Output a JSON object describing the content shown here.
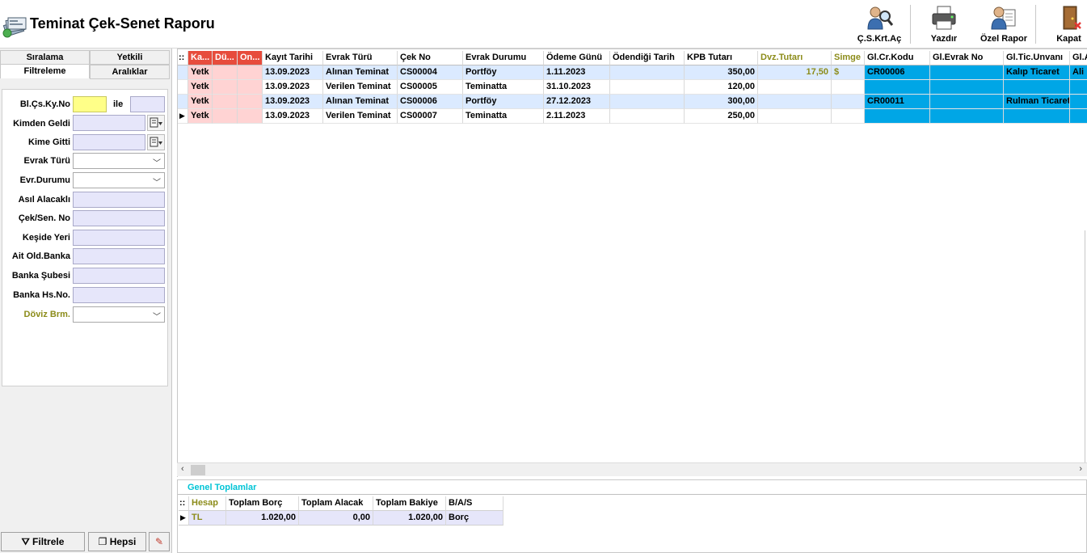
{
  "title": "Teminat Çek-Senet Raporu",
  "toolbar": {
    "cs_krt_ac": "Ç.S.Krt.Aç",
    "yazdir": "Yazdır",
    "ozel_rapor": "Özel Rapor",
    "kapat": "Kapat"
  },
  "tabs": {
    "siralama": "Sıralama",
    "yetkili": "Yetkili",
    "filtreleme": "Filtreleme",
    "araliklar": "Aralıklar"
  },
  "filters": {
    "bl_cs_ky_no": "Bl.Çs.Ky.No",
    "ile": "ile",
    "kimden_geldi": "Kimden Geldi",
    "kime_gitti": "Kime Gitti",
    "evrak_turu": "Evrak Türü",
    "evr_durumu": "Evr.Durumu",
    "asil_alacakli": "Asıl Alacaklı",
    "cek_sen_no": "Çek/Sen. No",
    "keside_yeri": "Keşide Yeri",
    "ait_old_banka": "Ait Old.Banka",
    "banka_subesi": "Banka Şubesi",
    "banka_hs_no": "Banka Hs.No.",
    "doviz_brm": "Döviz Brm."
  },
  "buttons": {
    "filtrele": "Filtrele",
    "hepsi": "Hepsi"
  },
  "grid": {
    "corner": "::",
    "columns": [
      "Ka...",
      "Dü...",
      "On...",
      "Kayıt Tarihi",
      "Evrak Türü",
      "Çek No",
      "Evrak Durumu",
      "Ödeme Günü",
      "Ödendiği Tarih",
      "KPB Tutarı",
      "Dvz.Tutarı",
      "Simge",
      "Gl.Cr.Kodu",
      "Gl.Evrak No",
      "Gl.Tic.Unvanı",
      "Gl.A"
    ],
    "rows": [
      {
        "ka": "Yetk",
        "kayit_tarihi": "13.09.2023",
        "evrak_turu": "Alınan Teminat",
        "cek_no": "CS00004",
        "evrak_durumu": "Portföy",
        "odeme_gunu": "1.11.2023",
        "odendigi_tarih": "",
        "kpb_tutari": "350,00",
        "dvz_tutari": "17,50",
        "simge": "$",
        "gl_cr_kodu": "CR00006",
        "gl_evrak_no": "",
        "gl_tic_unvani": "Kalıp Ticaret",
        "gl_a": "Ali"
      },
      {
        "ka": "Yetk",
        "kayit_tarihi": "13.09.2023",
        "evrak_turu": "Verilen Teminat",
        "cek_no": "CS00005",
        "evrak_durumu": "Teminatta",
        "odeme_gunu": "31.10.2023",
        "odendigi_tarih": "",
        "kpb_tutari": "120,00",
        "dvz_tutari": "",
        "simge": "",
        "gl_cr_kodu": "",
        "gl_evrak_no": "",
        "gl_tic_unvani": "",
        "gl_a": ""
      },
      {
        "ka": "Yetk",
        "kayit_tarihi": "13.09.2023",
        "evrak_turu": "Alınan Teminat",
        "cek_no": "CS00006",
        "evrak_durumu": "Portföy",
        "odeme_gunu": "27.12.2023",
        "odendigi_tarih": "",
        "kpb_tutari": "300,00",
        "dvz_tutari": "",
        "simge": "",
        "gl_cr_kodu": "CR00011",
        "gl_evrak_no": "",
        "gl_tic_unvani": "Rulman Ticaret",
        "gl_a": ""
      },
      {
        "ka": "Yetk",
        "kayit_tarihi": "13.09.2023",
        "evrak_turu": "Verilen Teminat",
        "cek_no": "CS00007",
        "evrak_durumu": "Teminatta",
        "odeme_gunu": "2.11.2023",
        "odendigi_tarih": "",
        "kpb_tutari": "250,00",
        "dvz_tutari": "",
        "simge": "",
        "gl_cr_kodu": "",
        "gl_evrak_no": "",
        "gl_tic_unvani": "",
        "gl_a": ""
      }
    ]
  },
  "totals": {
    "title": "Genel Toplamlar",
    "corner": "::",
    "columns": [
      "Hesap",
      "Toplam Borç",
      "Toplam Alacak",
      "Toplam Bakiye",
      "B/A/S"
    ],
    "row": {
      "hesap": "TL",
      "toplam_borc": "1.020,00",
      "toplam_alacak": "0,00",
      "toplam_bakiye": "1.020,00",
      "bas": "Borç"
    }
  },
  "colors": {
    "red_header": "#e74c3c",
    "pink_cell": "#ffd3d3",
    "blue_cell": "#00a6e6",
    "alt_row": "#dbeaff",
    "yellow_input": "#ffff88",
    "lavender_input": "#e6e6fa",
    "totals_title": "#00c4d6",
    "olive_text": "#8c8c1a"
  }
}
